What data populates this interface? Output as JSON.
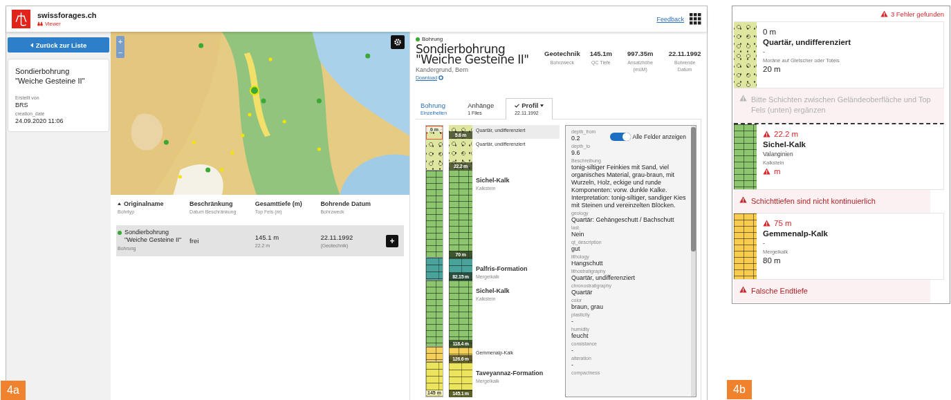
{
  "panel_a": {
    "label": "4a",
    "header": {
      "site": "swissforages.ch",
      "app": "Viewer",
      "feedback": "Feedback"
    },
    "sidebar": {
      "back_button": "Zurück zur Liste",
      "card": {
        "title": "Sondierbohrung\n\"Weiche Gesteine II\"",
        "fields": [
          {
            "label": "Erstellt von",
            "value": "BRS"
          },
          {
            "label": "creation_date",
            "value": "24.09.2020 11:06"
          }
        ]
      }
    },
    "map": {
      "zoom_in": "+",
      "zoom_out": "−"
    },
    "table": {
      "columns": [
        {
          "label": "Originalname",
          "sub": "Bohrtyp",
          "sorted": true
        },
        {
          "label": "Beschränkung",
          "sub": "Datum Beschränkung",
          "sorted": false
        },
        {
          "label": "Gesamttiefe (m)",
          "sub": "Top Fels (m)",
          "sorted": false
        },
        {
          "label": "Bohrende Datum",
          "sub": "Bohrzweck",
          "sorted": false
        }
      ],
      "rows": [
        {
          "selected": true,
          "color": "#3aa935",
          "name": "Sondierbohrung\n\"Weiche Gesteine II\"",
          "type": "Bohrung",
          "restriction": "frei",
          "depth": "145.1 m",
          "top_rock": "22.2 m",
          "date": "22.11.1992",
          "purpose": "(Geotechnik)",
          "action": "+"
        }
      ]
    },
    "detail": {
      "kind_label": "Bohrung",
      "status": {
        "color": "#3aa935"
      },
      "title": "Sondierbohrung\n\"Weiche Gesteine II\"",
      "location": "Kandergrund, Bern",
      "download": "Download",
      "stats": [
        {
          "value": "Geotechnik",
          "label": "Bohrzweck"
        },
        {
          "value": "145.1m",
          "label": "QC Tiefe"
        },
        {
          "value": "997.35m",
          "label": "Ansatzhöhe (müM)"
        },
        {
          "value": "22.11.1992",
          "label": "Bohrende Datum"
        }
      ],
      "tabs": [
        {
          "label": "Bohrung",
          "sub": "Einzelheiten",
          "kind": "link",
          "selected": false,
          "dropdown": false
        },
        {
          "label": "Anhänge",
          "sub": "1 Files",
          "kind": "plain",
          "selected": false,
          "dropdown": false
        },
        {
          "label": "Profil",
          "sub": "22.11.1992",
          "kind": "plain",
          "selected": true,
          "dropdown": true
        }
      ],
      "profile": {
        "top": "0 m",
        "bottom": "145 m",
        "layers": [
          {
            "name": "Quartär, undifferenziert",
            "bottom": "5.6 m",
            "color": "#dfe6a0",
            "kind": "gravel",
            "selected": true
          },
          {
            "name": "Quartär, undifferenziert",
            "bottom": "22.2 m",
            "color": "#dfe6a0",
            "kind": "gravel",
            "selected": false
          },
          {
            "name": "Sichel-Kalk",
            "lithology": "Kalkstein",
            "bottom": "70 m",
            "color": "#8dc56f",
            "kind": "limestone",
            "selected": false
          },
          {
            "name": "Palfris-Formation",
            "lithology": "Mergelkalk",
            "bottom": "82.15 m",
            "color": "#4aa39a",
            "kind": "marl",
            "selected": false
          },
          {
            "name": "Sichel-Kalk",
            "lithology": "Kalkstein",
            "bottom": "118.4 m",
            "color": "#8dc56f",
            "kind": "limestone",
            "selected": false
          },
          {
            "name": "Gemmenalp-Kalk",
            "bottom": "126.6 m",
            "color": "#f3cf5c",
            "kind": "limestone",
            "selected": false
          },
          {
            "name": "Taveyannaz-Formation",
            "lithology": "Mergelkalk",
            "bottom": "145.1 m",
            "color": "#ede45e",
            "kind": "marl",
            "selected": false
          }
        ],
        "toggle": {
          "label": "Alle Felder anzeigen",
          "on": true
        },
        "fields": [
          {
            "label": "depth_from",
            "value": "0.2"
          },
          {
            "label": "depth_to",
            "value": "9.6"
          },
          {
            "label": "Beschreibung",
            "value": "tonig-siltiger Feinkies mit Sand, viel organisches Material, grau-braun, mit Wurzeln, Holz, eckige und runde Komponenten: vorw. dunkle Kalke. Interpretation: tonig-siltiger, sandiger Kies mit Steinen und vereinzelten Blöcken."
          },
          {
            "label": "geology",
            "value": "Quartär: Gehängeschutt / Bachschutt"
          },
          {
            "label": "last",
            "value": "Nein"
          },
          {
            "label": "qt_description",
            "value": "gut"
          },
          {
            "label": "lithology",
            "value": "Hangschutt"
          },
          {
            "label": "lithostratigraphy",
            "value": "Quartär, undifferenziert"
          },
          {
            "label": "chronostratigraphy",
            "value": "Quartär"
          },
          {
            "label": "color",
            "value": "braun, grau"
          },
          {
            "label": "plasticity",
            "value": "-"
          },
          {
            "label": "humidity",
            "value": "feucht"
          },
          {
            "label": "consistance",
            "value": "-"
          },
          {
            "label": "alteration",
            "value": "-"
          },
          {
            "label": "compactness"
          }
        ]
      }
    }
  },
  "panel_b": {
    "label": "4b",
    "summary": "3 Fehler gefunden",
    "items": [
      {
        "kind": "gravel",
        "color": "#dfe6a0",
        "rock_top": false,
        "top": "0 m",
        "top_error": false,
        "name": "Quartär, undifferenziert",
        "chrono": "-",
        "lithology": "Moräne auf Gletscher oder Toteis",
        "bottom": "20 m",
        "bottom_error": false
      },
      {
        "kind": "notice",
        "text": "Bitte Schichten zwischen Geländeoberfläche und Top Fels (unten) ergänzen"
      },
      {
        "kind": "limestone",
        "color": "#8dc56f",
        "rock_top": true,
        "top": "22.2 m",
        "top_error": true,
        "name": "Sichel-Kalk",
        "chrono": "Valanginien",
        "lithology": "Kalkstein",
        "bottom": "m",
        "bottom_error": true
      },
      {
        "kind": "error",
        "text": "Schichttiefen sind nicht kontinuierlich"
      },
      {
        "kind": "limestone",
        "color": "#f6cb4e",
        "rock_top": false,
        "top": "75 m",
        "top_error": true,
        "name": "Gemmenalp-Kalk",
        "chrono": "-",
        "lithology": "Mergelkalk",
        "bottom": "80 m",
        "bottom_error": false
      },
      {
        "kind": "error",
        "text": "Falsche Endtiefe"
      }
    ]
  }
}
